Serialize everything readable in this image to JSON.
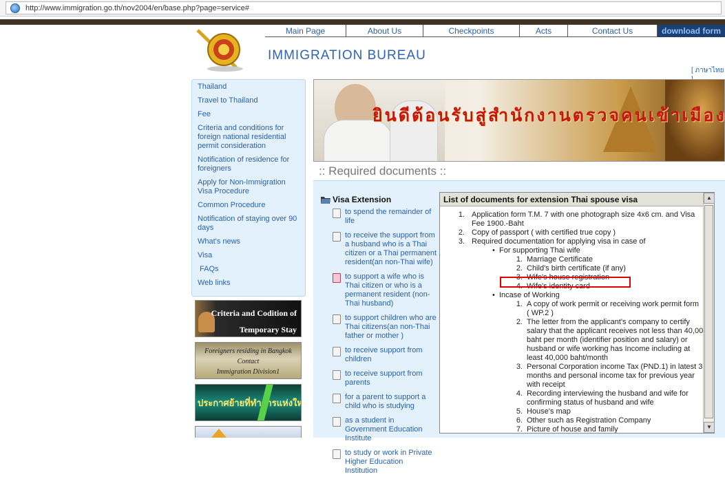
{
  "browser": {
    "url": "http://www.immigration.go.th/nov2004/en/base.php?page=service#"
  },
  "nav": [
    {
      "label": "Main Page"
    },
    {
      "label": "About Us"
    },
    {
      "label": "Checkpoints"
    },
    {
      "label": "Acts"
    },
    {
      "label": "Contact Us"
    },
    {
      "label": "download form"
    }
  ],
  "site": {
    "title": "IMMIGRATION BUREAU",
    "thai_link": "[ ภาษาไทย ]"
  },
  "sidebar": [
    "Thailand",
    "Travel to Thailand",
    "Fee",
    "Criteria and conditions for foreign national residential permit consideration",
    "Notification of residence for foreigners",
    "Apply for Non-Immigration Visa Procedure",
    "Common Procedure",
    "Notification of staying over 90 days",
    "What's news",
    "Visa",
    " FAQs",
    "Web links"
  ],
  "banners": {
    "b1": "Criteria and Codition of Temporary Stay",
    "b2a": "Foreigners residing in Bangkok",
    "b2b": "Contact",
    "b2c": "Immigration Division1",
    "b3": "ประกาศย้ายที่ทำการแห่งใหม่"
  },
  "hero_text": "ยินดีต้อนรับสู่สำนักงานตรวจคนเข้าเมือง",
  "section_title": ":: Required documents ::",
  "visa": {
    "heading": "Visa Extension",
    "items": [
      "to spend the remainder of life",
      "to receive the support from a husband who is a Thai citizen or a Thai permanent resident(an non-Thai wife)",
      "to support a wife who is Thai citizen or who is a permanent resident (non-Thai husband)",
      "to support children who are Thai citizens(an non-Thai father or mother )",
      "to receive support from children",
      "to receive support from parents",
      "for a parent to support a child who is studying",
      "as a student in Government Education Institute",
      "to study or work in Private Higher Education Institution"
    ]
  },
  "docs": {
    "header": "List of documents for extension Thai spouse visa",
    "lines": [
      "Application form T.M. 7 with one photograph size 4x6 cm. and Visa",
      "Fee 1900.-Baht",
      "Copy of passport ( with certified true copy )",
      "Required documentation for applying visa in case of",
      "For supporting Thai wife",
      "Marriage Certificate",
      "Child's birth certificate (if any)",
      "Wife's house registration",
      "Wife's identity card",
      "Incase of Working",
      "A copy of work permit or receiving work permit form",
      "( WP.2 )",
      "The letter from the applicant's company to certify",
      "salary that the applicant receives not less than 40,000",
      "baht per month (identifier position and salary) or",
      "husband or wife working has Income including at",
      "least 40,000 baht/month",
      "Personal Corporation income Tax (PND.1) in latest 3",
      "months and personal income tax for previous year",
      "with receipt",
      "Recording interviewing the husband and wife for",
      "confirming status of husband and wife",
      "House's map",
      "Other such as Registration Company",
      "Picture of house and family"
    ]
  }
}
